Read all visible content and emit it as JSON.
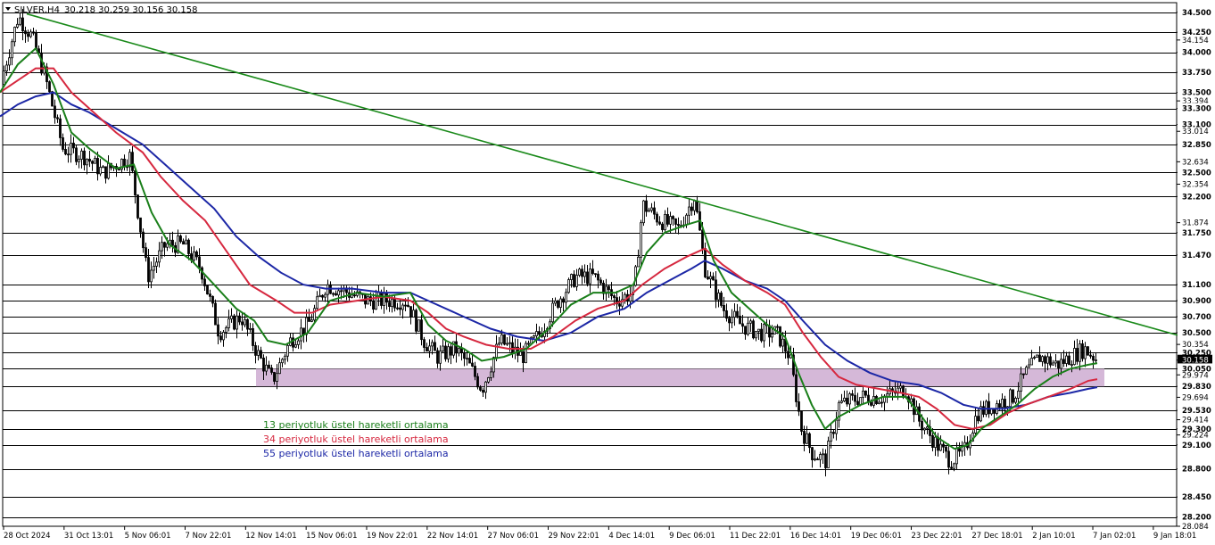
{
  "header": {
    "symbol": "SILVER,H4",
    "ohlc": "30.218 30.259 30.156 30.158"
  },
  "legend": [
    {
      "label": "13 periyotluk üstel hareketli ortalama",
      "color": "#1a7f1a"
    },
    {
      "label": "34 periyotluk üstel hareketli ortalama",
      "color": "#d6283f"
    },
    {
      "label": "55 periyotluk üstel hareketli ortalama",
      "color": "#1c27a6"
    }
  ],
  "colors": {
    "background": "#ffffff",
    "candle": "#000000",
    "trendline": "#1a8a1a",
    "support_zone": "#d5b8d8",
    "current_price_tag": "#000000"
  },
  "chart_data": {
    "type": "candlestick",
    "title": "SILVER,H4",
    "y_ticks": [
      34.5,
      34.25,
      34.154,
      34.0,
      33.75,
      33.5,
      33.394,
      33.3,
      33.1,
      33.014,
      32.85,
      32.634,
      32.5,
      32.354,
      32.2,
      31.874,
      31.75,
      31.47,
      31.1,
      30.9,
      30.7,
      30.5,
      30.354,
      30.25,
      30.158,
      30.05,
      29.974,
      29.83,
      29.694,
      29.53,
      29.414,
      29.3,
      29.224,
      29.1,
      28.8,
      28.45,
      28.2,
      28.084
    ],
    "y_tick_labels": [
      "34.500",
      "34.250",
      "34.154",
      "34.000",
      "33.750",
      "33.500",
      "33.394",
      "33.300",
      "33.100",
      "33.014",
      "32.850",
      "32.634",
      "32.500",
      "32.354",
      "32.200",
      "31.874",
      "31.750",
      "31.470",
      "31.100",
      "30.900",
      "30.700",
      "30.500",
      "30.354",
      "30.250",
      "30.158",
      "30.050",
      "29.974",
      "29.830",
      "29.694",
      "29.530",
      "29.414",
      "29.300",
      "29.224",
      "29.100",
      "28.800",
      "28.450",
      "28.200",
      "28.084"
    ],
    "horizontal_levels": [
      34.5,
      34.25,
      34.0,
      33.75,
      33.5,
      33.3,
      33.1,
      32.85,
      32.5,
      32.2,
      31.75,
      31.47,
      31.1,
      30.9,
      30.7,
      30.5,
      30.25,
      30.05,
      29.83,
      29.53,
      29.3,
      29.1,
      28.8,
      28.45,
      28.2
    ],
    "ylim": [
      28.084,
      34.62
    ],
    "current_price": 30.158,
    "x_labels": [
      "28 Oct 2024",
      "31 Oct 13:01",
      "5 Nov 06:01",
      "7 Nov 22:01",
      "12 Nov 14:01",
      "15 Nov 06:01",
      "19 Nov 22:01",
      "22 Nov 14:01",
      "27 Nov 06:01",
      "29 Nov 22:01",
      "4 Dec 14:01",
      "9 Dec 06:01",
      "11 Dec 22:01",
      "16 Dec 14:01",
      "19 Dec 06:01",
      "23 Dec 22:01",
      "27 Dec 18:01",
      "2 Jan 10:01",
      "7 Jan 02:01",
      "9 Jan 18:01"
    ],
    "price_path": [
      [
        0,
        33.6
      ],
      [
        20,
        34.45
      ],
      [
        35,
        34.2
      ],
      [
        50,
        33.7
      ],
      [
        70,
        32.8
      ],
      [
        95,
        32.7
      ],
      [
        115,
        32.5
      ],
      [
        145,
        32.7
      ],
      [
        165,
        31.2
      ],
      [
        185,
        31.6
      ],
      [
        205,
        31.6
      ],
      [
        225,
        31.3
      ],
      [
        245,
        30.5
      ],
      [
        270,
        30.7
      ],
      [
        290,
        30.2
      ],
      [
        305,
        29.9
      ],
      [
        325,
        30.4
      ],
      [
        345,
        30.6
      ],
      [
        365,
        31.1
      ],
      [
        390,
        31.0
      ],
      [
        410,
        30.9
      ],
      [
        430,
        30.9
      ],
      [
        455,
        30.9
      ],
      [
        475,
        30.4
      ],
      [
        490,
        30.2
      ],
      [
        510,
        30.3
      ],
      [
        525,
        30.1
      ],
      [
        540,
        29.8
      ],
      [
        560,
        30.4
      ],
      [
        585,
        30.2
      ],
      [
        605,
        30.5
      ],
      [
        625,
        30.9
      ],
      [
        645,
        31.2
      ],
      [
        665,
        31.2
      ],
      [
        690,
        30.9
      ],
      [
        710,
        31.0
      ],
      [
        720,
        32.1
      ],
      [
        740,
        31.9
      ],
      [
        760,
        31.8
      ],
      [
        778,
        32.2
      ],
      [
        790,
        31.3
      ],
      [
        810,
        30.8
      ],
      [
        830,
        30.6
      ],
      [
        850,
        30.5
      ],
      [
        870,
        30.5
      ],
      [
        885,
        30.2
      ],
      [
        898,
        29.3
      ],
      [
        910,
        29.0
      ],
      [
        925,
        28.9
      ],
      [
        940,
        29.6
      ],
      [
        965,
        29.7
      ],
      [
        990,
        29.7
      ],
      [
        1015,
        29.8
      ],
      [
        1030,
        29.4
      ],
      [
        1050,
        29.1
      ],
      [
        1065,
        28.9
      ],
      [
        1080,
        29.0
      ],
      [
        1095,
        29.5
      ],
      [
        1115,
        29.6
      ],
      [
        1135,
        29.7
      ],
      [
        1150,
        30.0
      ],
      [
        1165,
        30.2
      ],
      [
        1185,
        30.1
      ],
      [
        1200,
        30.2
      ],
      [
        1215,
        30.3
      ],
      [
        1230,
        30.16
      ]
    ],
    "ema13_path": [
      [
        0,
        33.5
      ],
      [
        20,
        33.85
      ],
      [
        40,
        34.05
      ],
      [
        60,
        33.6
      ],
      [
        80,
        33.0
      ],
      [
        100,
        32.8
      ],
      [
        130,
        32.55
      ],
      [
        150,
        32.6
      ],
      [
        170,
        32.0
      ],
      [
        190,
        31.6
      ],
      [
        215,
        31.4
      ],
      [
        240,
        31.1
      ],
      [
        265,
        30.8
      ],
      [
        285,
        30.65
      ],
      [
        300,
        30.4
      ],
      [
        320,
        30.35
      ],
      [
        345,
        30.5
      ],
      [
        370,
        30.9
      ],
      [
        400,
        31.0
      ],
      [
        430,
        30.95
      ],
      [
        460,
        31.0
      ],
      [
        480,
        30.6
      ],
      [
        500,
        30.4
      ],
      [
        520,
        30.3
      ],
      [
        540,
        30.15
      ],
      [
        565,
        30.2
      ],
      [
        590,
        30.3
      ],
      [
        615,
        30.55
      ],
      [
        640,
        30.85
      ],
      [
        665,
        31.0
      ],
      [
        690,
        31.0
      ],
      [
        710,
        31.1
      ],
      [
        725,
        31.5
      ],
      [
        745,
        31.75
      ],
      [
        770,
        31.85
      ],
      [
        785,
        31.9
      ],
      [
        800,
        31.4
      ],
      [
        820,
        31.0
      ],
      [
        840,
        30.8
      ],
      [
        860,
        30.6
      ],
      [
        880,
        30.45
      ],
      [
        895,
        30.0
      ],
      [
        910,
        29.6
      ],
      [
        925,
        29.3
      ],
      [
        940,
        29.45
      ],
      [
        965,
        29.6
      ],
      [
        990,
        29.7
      ],
      [
        1015,
        29.7
      ],
      [
        1030,
        29.5
      ],
      [
        1050,
        29.2
      ],
      [
        1070,
        29.05
      ],
      [
        1085,
        29.1
      ],
      [
        1100,
        29.3
      ],
      [
        1120,
        29.45
      ],
      [
        1140,
        29.6
      ],
      [
        1160,
        29.8
      ],
      [
        1180,
        29.95
      ],
      [
        1200,
        30.05
      ],
      [
        1220,
        30.1
      ],
      [
        1230,
        30.12
      ]
    ],
    "ema34_path": [
      [
        0,
        33.5
      ],
      [
        20,
        33.65
      ],
      [
        40,
        33.8
      ],
      [
        60,
        33.8
      ],
      [
        80,
        33.5
      ],
      [
        100,
        33.3
      ],
      [
        130,
        33.0
      ],
      [
        160,
        32.75
      ],
      [
        180,
        32.45
      ],
      [
        205,
        32.15
      ],
      [
        230,
        31.9
      ],
      [
        255,
        31.5
      ],
      [
        280,
        31.1
      ],
      [
        310,
        30.9
      ],
      [
        330,
        30.75
      ],
      [
        350,
        30.75
      ],
      [
        370,
        30.85
      ],
      [
        400,
        30.9
      ],
      [
        430,
        30.95
      ],
      [
        460,
        30.9
      ],
      [
        480,
        30.75
      ],
      [
        500,
        30.55
      ],
      [
        520,
        30.45
      ],
      [
        545,
        30.35
      ],
      [
        570,
        30.3
      ],
      [
        595,
        30.3
      ],
      [
        620,
        30.45
      ],
      [
        645,
        30.65
      ],
      [
        670,
        30.8
      ],
      [
        700,
        30.9
      ],
      [
        720,
        31.1
      ],
      [
        745,
        31.3
      ],
      [
        770,
        31.45
      ],
      [
        790,
        31.55
      ],
      [
        810,
        31.35
      ],
      [
        835,
        31.15
      ],
      [
        860,
        31.0
      ],
      [
        880,
        30.85
      ],
      [
        900,
        30.5
      ],
      [
        920,
        30.2
      ],
      [
        940,
        29.95
      ],
      [
        960,
        29.85
      ],
      [
        985,
        29.8
      ],
      [
        1010,
        29.75
      ],
      [
        1030,
        29.7
      ],
      [
        1050,
        29.55
      ],
      [
        1070,
        29.35
      ],
      [
        1090,
        29.3
      ],
      [
        1110,
        29.35
      ],
      [
        1130,
        29.5
      ],
      [
        1150,
        29.6
      ],
      [
        1175,
        29.7
      ],
      [
        1200,
        29.8
      ],
      [
        1220,
        29.9
      ],
      [
        1230,
        29.92
      ]
    ],
    "ema55_path": [
      [
        0,
        33.2
      ],
      [
        20,
        33.35
      ],
      [
        40,
        33.45
      ],
      [
        60,
        33.5
      ],
      [
        80,
        33.35
      ],
      [
        100,
        33.25
      ],
      [
        130,
        33.05
      ],
      [
        160,
        32.85
      ],
      [
        185,
        32.6
      ],
      [
        210,
        32.35
      ],
      [
        240,
        32.05
      ],
      [
        265,
        31.7
      ],
      [
        290,
        31.45
      ],
      [
        315,
        31.25
      ],
      [
        340,
        31.1
      ],
      [
        365,
        31.05
      ],
      [
        395,
        31.05
      ],
      [
        430,
        31.0
      ],
      [
        460,
        31.0
      ],
      [
        490,
        30.85
      ],
      [
        520,
        30.7
      ],
      [
        550,
        30.55
      ],
      [
        580,
        30.45
      ],
      [
        610,
        30.4
      ],
      [
        640,
        30.5
      ],
      [
        670,
        30.7
      ],
      [
        700,
        30.8
      ],
      [
        725,
        31.0
      ],
      [
        750,
        31.15
      ],
      [
        775,
        31.3
      ],
      [
        790,
        31.4
      ],
      [
        810,
        31.3
      ],
      [
        835,
        31.15
      ],
      [
        860,
        31.05
      ],
      [
        880,
        30.9
      ],
      [
        900,
        30.65
      ],
      [
        925,
        30.35
      ],
      [
        950,
        30.15
      ],
      [
        975,
        30.0
      ],
      [
        1000,
        29.9
      ],
      [
        1030,
        29.85
      ],
      [
        1055,
        29.75
      ],
      [
        1080,
        29.6
      ],
      [
        1100,
        29.55
      ],
      [
        1125,
        29.55
      ],
      [
        1150,
        29.6
      ],
      [
        1175,
        29.7
      ],
      [
        1200,
        29.75
      ],
      [
        1220,
        29.8
      ],
      [
        1230,
        29.82
      ]
    ],
    "trendline": {
      "from": [
        30,
        34.48
      ],
      "to": [
        1320,
        30.47
      ]
    },
    "support_zone": {
      "from_bar_x": 287,
      "to_bar_x": 1238,
      "low": 29.83,
      "high": 30.05
    }
  }
}
